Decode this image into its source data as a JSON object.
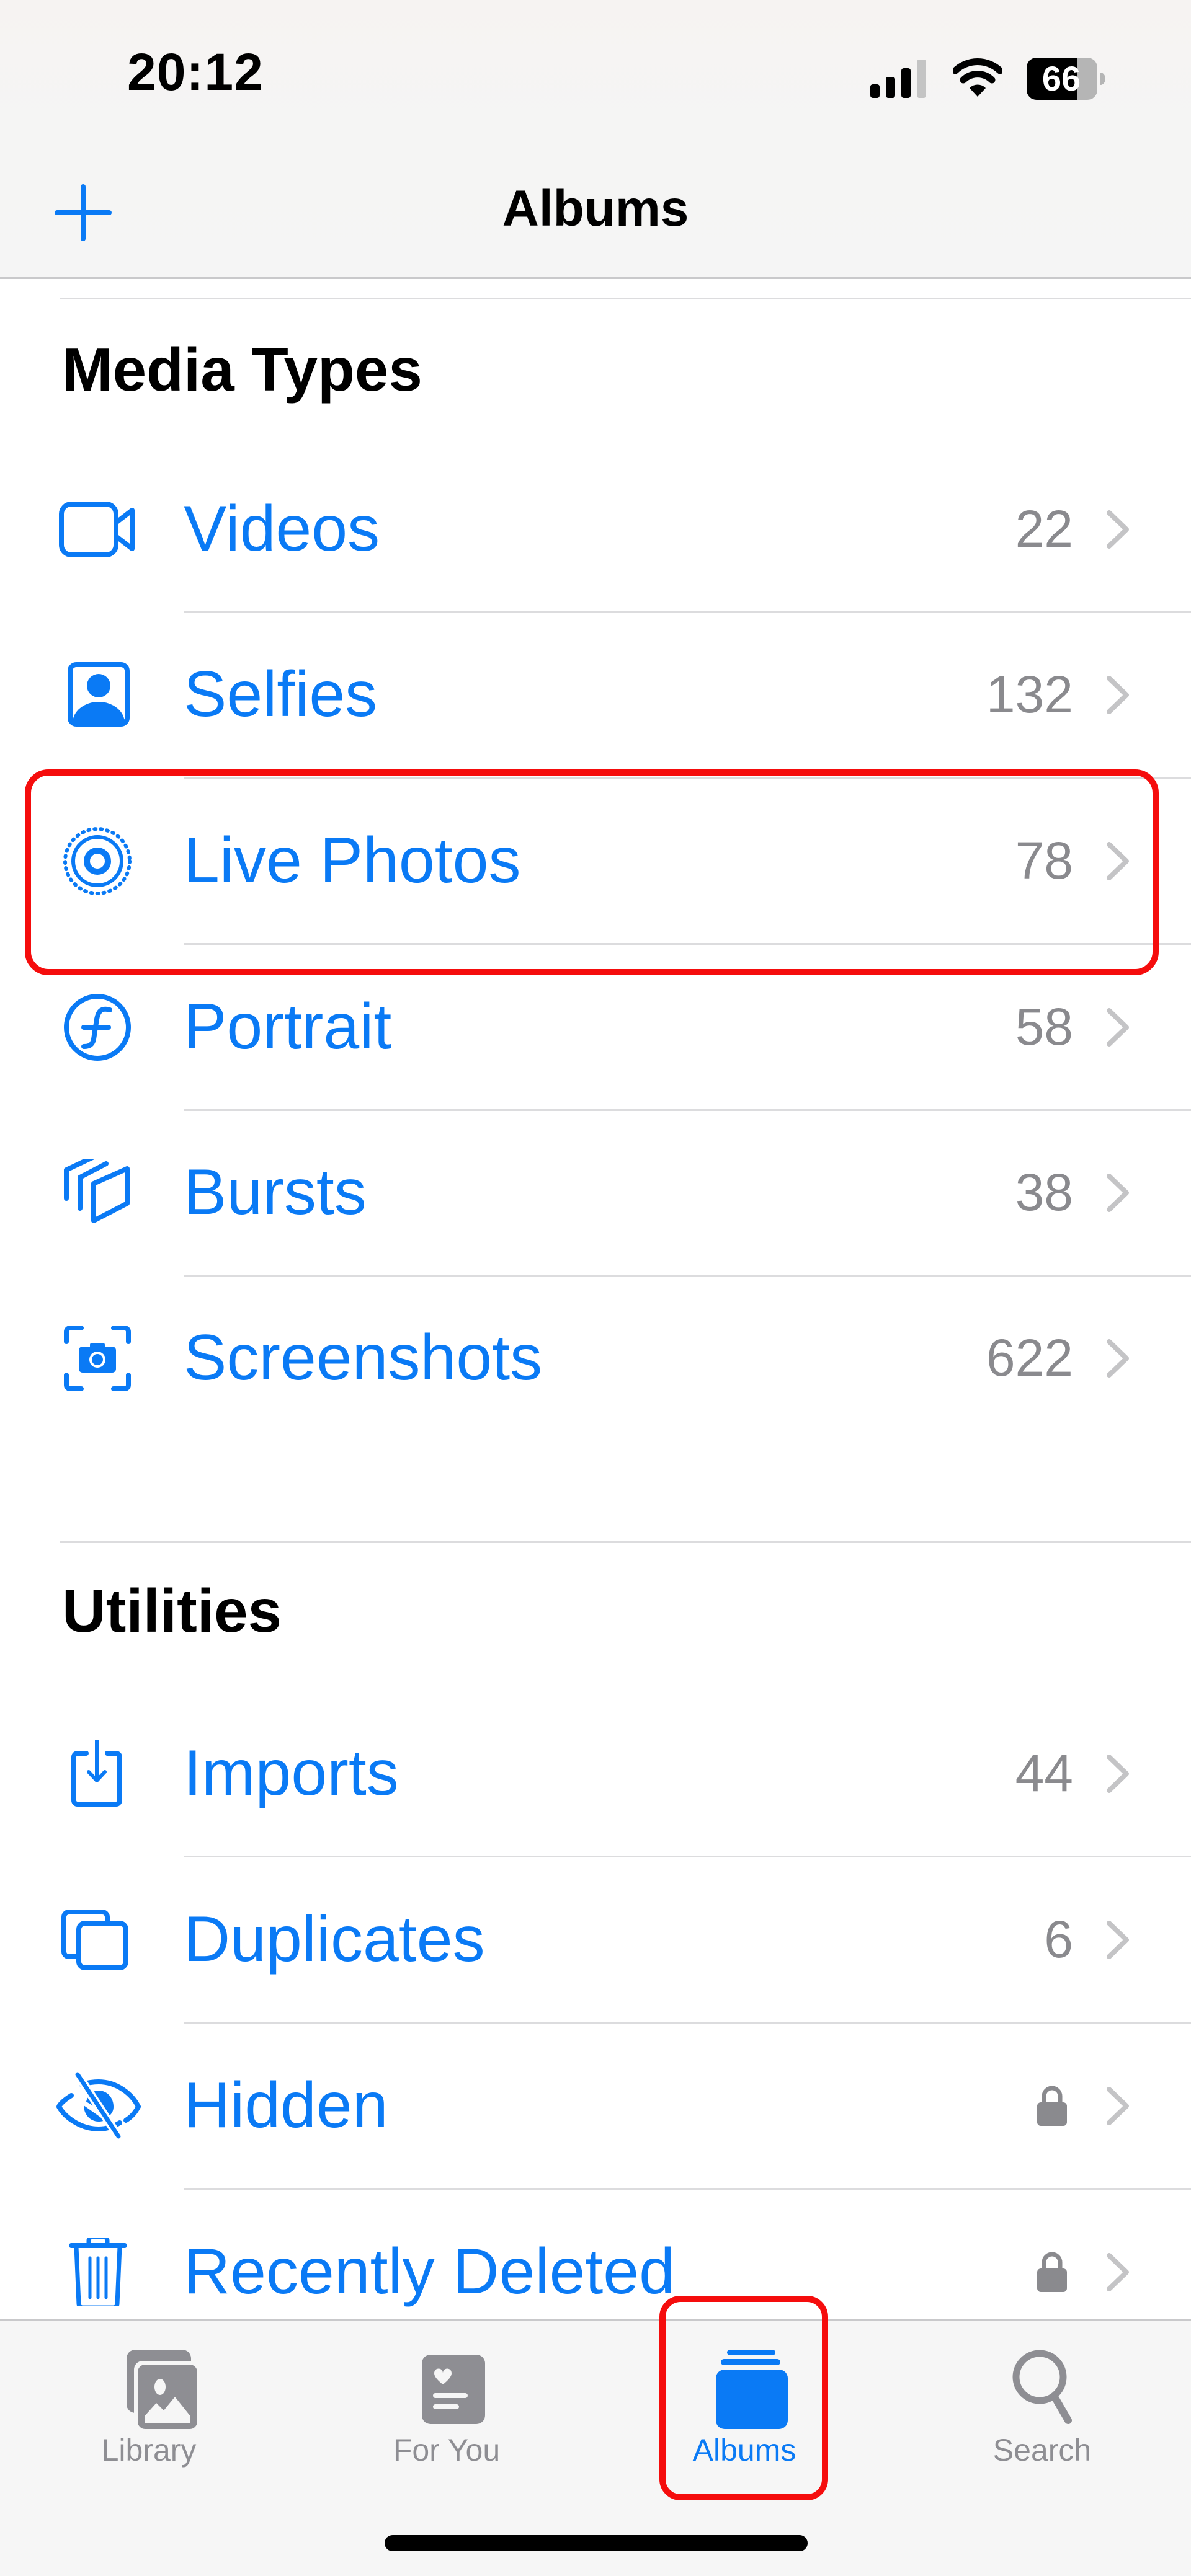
{
  "status_bar": {
    "time": "20:12",
    "signal_bars": 3,
    "signal_bars_total": 4,
    "wifi": "wifi-icon",
    "battery_percent": "66"
  },
  "nav": {
    "title": "Albums",
    "add_button_icon": "plus-icon"
  },
  "sections": [
    {
      "title": "Media Types",
      "items": [
        {
          "label": "Videos",
          "count": "22",
          "icon": "video-camera-icon",
          "locked": false
        },
        {
          "label": "Selfies",
          "count": "132",
          "icon": "selfie-person-icon",
          "locked": false
        },
        {
          "label": "Live Photos",
          "count": "78",
          "icon": "live-photo-icon",
          "locked": false,
          "highlighted": true
        },
        {
          "label": "Portrait",
          "count": "58",
          "icon": "portrait-aperture-icon",
          "locked": false
        },
        {
          "label": "Bursts",
          "count": "38",
          "icon": "burst-stack-icon",
          "locked": false
        },
        {
          "label": "Screenshots",
          "count": "622",
          "icon": "screenshot-camera-icon",
          "locked": false
        }
      ]
    },
    {
      "title": "Utilities",
      "items": [
        {
          "label": "Imports",
          "count": "44",
          "icon": "import-tray-icon",
          "locked": false
        },
        {
          "label": "Duplicates",
          "count": "6",
          "icon": "duplicates-icon",
          "locked": false
        },
        {
          "label": "Hidden",
          "count": "",
          "icon": "eye-slash-icon",
          "locked": true
        },
        {
          "label": "Recently Deleted",
          "count": "",
          "icon": "trash-icon",
          "locked": true
        }
      ]
    }
  ],
  "tab_bar": {
    "tabs": [
      {
        "label": "Library",
        "icon": "photo-library-icon",
        "active": false
      },
      {
        "label": "For You",
        "icon": "for-you-card-icon",
        "active": false
      },
      {
        "label": "Albums",
        "icon": "albums-stack-icon",
        "active": true,
        "highlighted": true
      },
      {
        "label": "Search",
        "icon": "magnifying-glass-icon",
        "active": false
      }
    ]
  },
  "colors": {
    "accent": "#0a7af5",
    "highlight": "#f50d0d",
    "secondary_text": "#8a8a8e",
    "chevron": "#c4c4c6"
  }
}
